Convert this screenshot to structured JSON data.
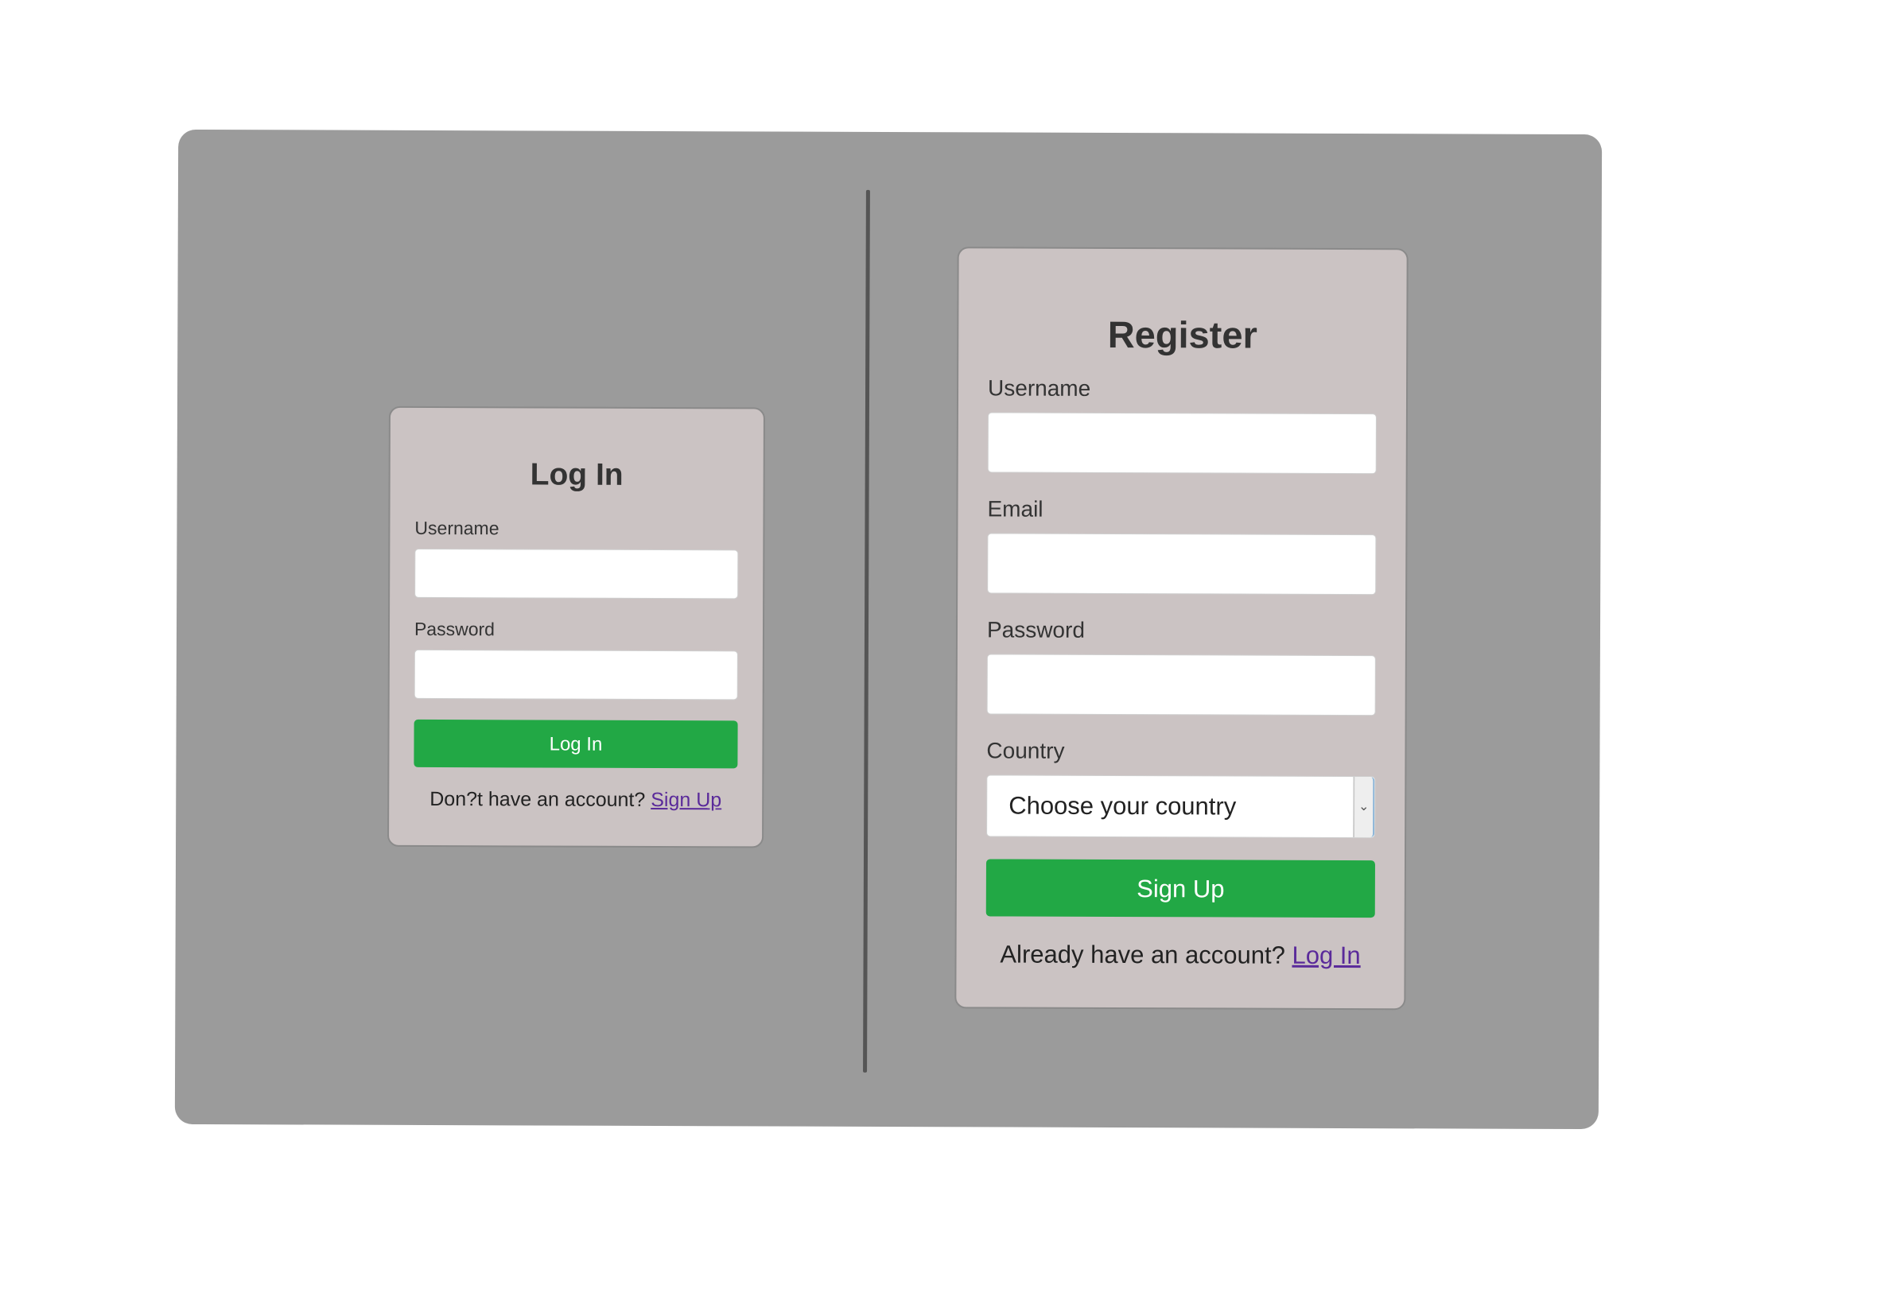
{
  "colors": {
    "page_background": "#ffffff",
    "panel_background": "#9b9b9b",
    "card_background": "#cbc3c3",
    "accent_green": "#22a845",
    "link_purple": "#5a2a9a"
  },
  "login": {
    "title": "Log In",
    "username_label": "Username",
    "username_value": "",
    "password_label": "Password",
    "password_value": "",
    "submit_label": "Log In",
    "footer_text": "Don?t have an account?",
    "footer_link": "Sign Up"
  },
  "register": {
    "title": "Register",
    "username_label": "Username",
    "username_value": "",
    "email_label": "Email",
    "email_value": "",
    "password_label": "Password",
    "password_value": "",
    "country_label": "Country",
    "country_selected": "Choose your country",
    "country_arrow_icon": "chevron-down-icon",
    "submit_label": "Sign Up",
    "footer_text": "Already have an account?",
    "footer_link": "Log In"
  }
}
